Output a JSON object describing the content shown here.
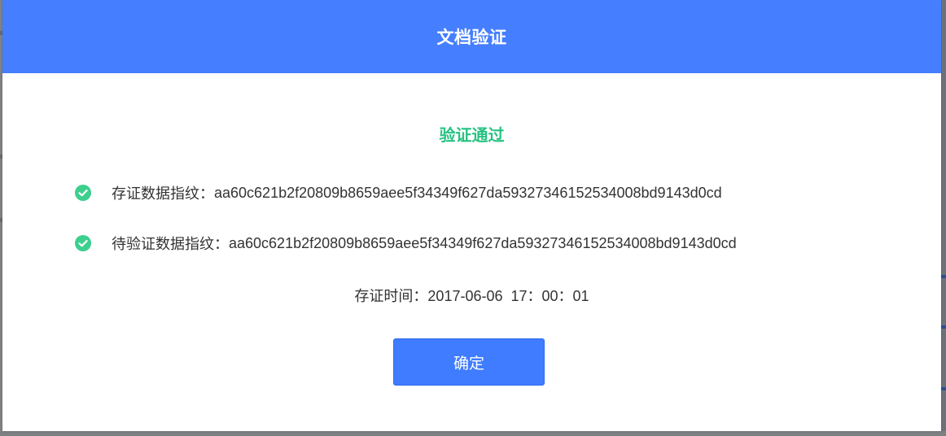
{
  "modal": {
    "title": "文档验证",
    "result_text": "验证通过",
    "rows": [
      {
        "label": "存证数据指纹：",
        "value": "aa60c621b2f20809b8659aee5f34349f627da59327346152534008bd9143d0cd",
        "icon": "check-circle-icon"
      },
      {
        "label": "待验证数据指纹：",
        "value": "aa60c621b2f20809b8659aee5f34349f627da59327346152534008bd9143d0cd",
        "icon": "check-circle-icon"
      }
    ],
    "time_label": "存证时间：",
    "time_value": "2017-06-06  17：00：01",
    "confirm_label": "确定"
  },
  "colors": {
    "header": "#457fff",
    "success": "#26c281",
    "button": "#3f7cff"
  }
}
